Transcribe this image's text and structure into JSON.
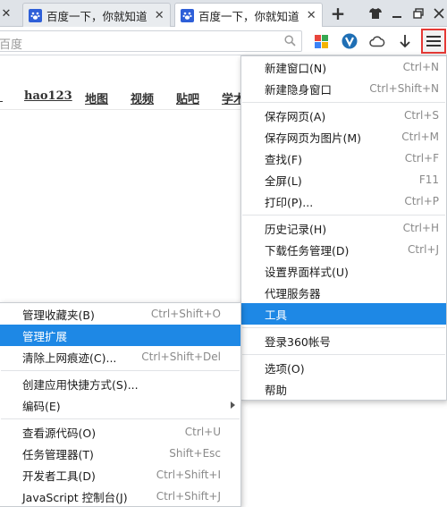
{
  "tabs": [
    {
      "title": "百度一下，你就知道",
      "close": "✕"
    },
    {
      "title": "百度一下，你就知道",
      "close": "✕"
    }
  ],
  "tab_bar": {
    "left_close": "✕",
    "new_tab": "+"
  },
  "address_bar": {
    "value": "百度"
  },
  "nav_links": [
    "hao123",
    "地图",
    "视频",
    "贴吧",
    "学术"
  ],
  "main_menu": {
    "items": [
      {
        "label": "新建窗口(N)",
        "shortcut": "Ctrl+N"
      },
      {
        "label": "新建隐身窗口",
        "shortcut": "Ctrl+Shift+N"
      },
      {
        "label": "保存网页(A)",
        "shortcut": "Ctrl+S"
      },
      {
        "label": "保存网页为图片(M)",
        "shortcut": "Ctrl+M"
      },
      {
        "label": "查找(F)",
        "shortcut": "Ctrl+F"
      },
      {
        "label": "全屏(L)",
        "shortcut": "F11"
      },
      {
        "label": "打印(P)...",
        "shortcut": "Ctrl+P"
      },
      {
        "label": "历史记录(H)",
        "shortcut": "Ctrl+H"
      },
      {
        "label": "下载任务管理(D)",
        "shortcut": "Ctrl+J"
      },
      {
        "label": "设置界面样式(U)",
        "shortcut": ""
      },
      {
        "label": "代理服务器",
        "shortcut": ""
      },
      {
        "label": "工具",
        "shortcut": ""
      },
      {
        "label": "登录360帐号",
        "shortcut": ""
      },
      {
        "label": "选项(O)",
        "shortcut": ""
      },
      {
        "label": "帮助",
        "shortcut": ""
      }
    ]
  },
  "tools_submenu": {
    "items": [
      {
        "label": "管理收藏夹(B)",
        "shortcut": "Ctrl+Shift+O"
      },
      {
        "label": "管理扩展",
        "shortcut": ""
      },
      {
        "label": "清除上网痕迹(C)...",
        "shortcut": "Ctrl+Shift+Del"
      },
      {
        "label": "创建应用快捷方式(S)...",
        "shortcut": ""
      },
      {
        "label": "编码(E)",
        "shortcut": ""
      },
      {
        "label": "查看源代码(O)",
        "shortcut": "Ctrl+U"
      },
      {
        "label": "任务管理器(T)",
        "shortcut": "Shift+Esc"
      },
      {
        "label": "开发者工具(D)",
        "shortcut": "Ctrl+Shift+I"
      },
      {
        "label": "JavaScript 控制台(J)",
        "shortcut": "Ctrl+Shift+J"
      }
    ]
  },
  "colors": {
    "highlight": "#1e88e5",
    "menu_button_outline": "#e53935",
    "favicon": "#2e5fd8"
  },
  "icons": [
    "close-icon",
    "paw-favicon-icon",
    "plus-icon",
    "shirt-icon",
    "minimize-icon",
    "restore-icon",
    "search-icon",
    "apps-grid-icon",
    "v-shield-icon",
    "cloud-icon",
    "download-icon",
    "hamburger-menu-icon",
    "chevron-right-icon"
  ]
}
